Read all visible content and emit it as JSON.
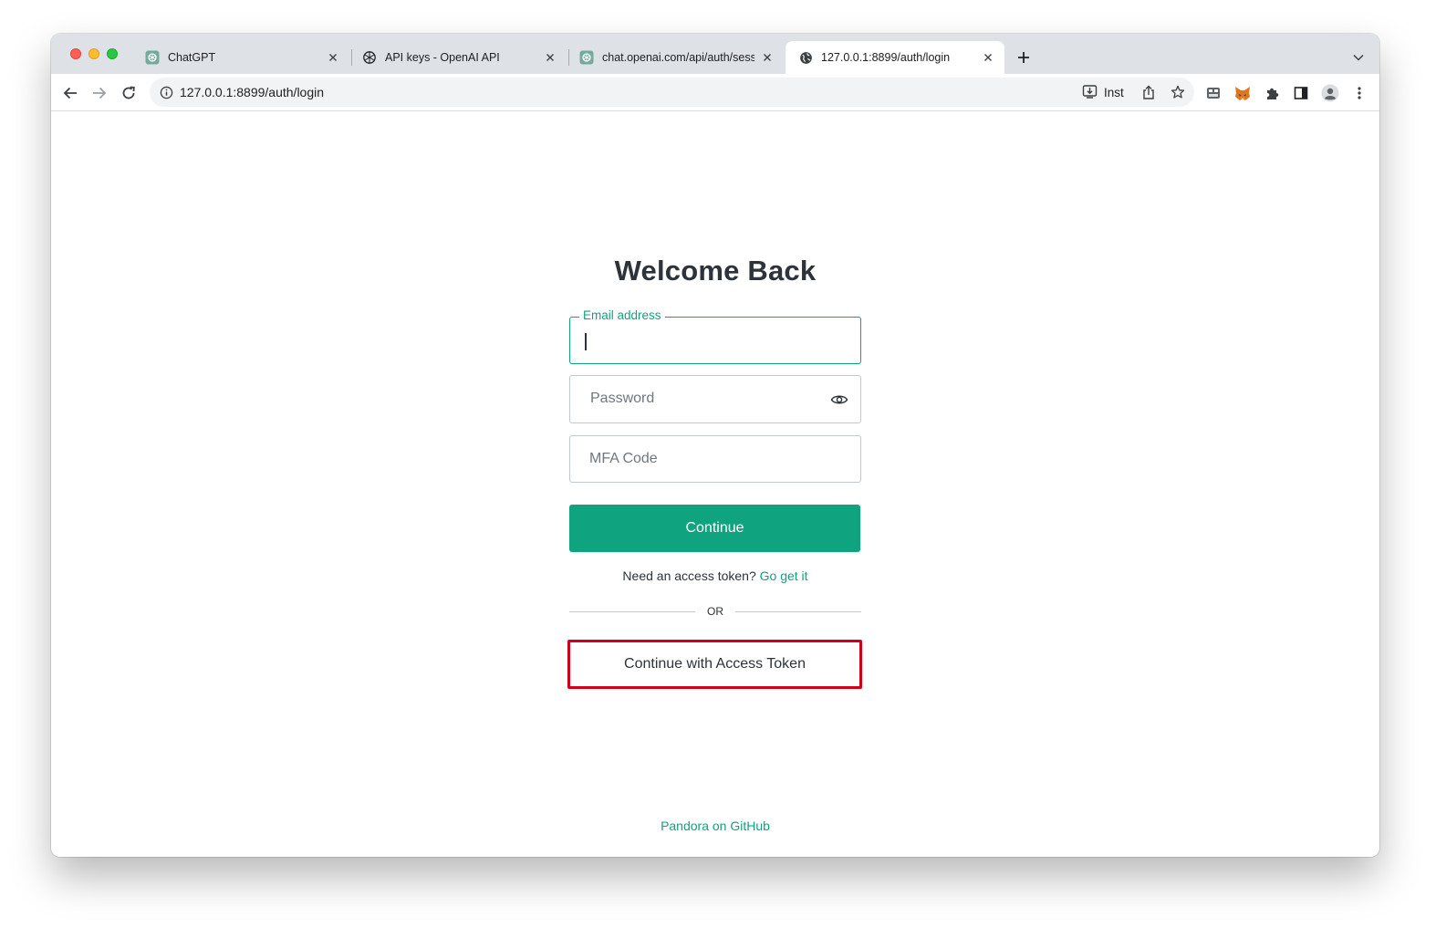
{
  "browser": {
    "tabs": [
      {
        "title": "ChatGPT",
        "icon": "chatgpt-icon"
      },
      {
        "title": "API keys - OpenAI API",
        "icon": "openai-icon"
      },
      {
        "title": "chat.openai.com/api/auth/session",
        "icon": "chatgpt-icon"
      },
      {
        "title": "127.0.0.1:8899/auth/login",
        "icon": "globe-icon"
      }
    ],
    "active_tab": 3,
    "address": "127.0.0.1:8899/auth/login",
    "install_label": "Inst"
  },
  "login": {
    "heading": "Welcome Back",
    "email_label": "Email address",
    "email_value": "",
    "password_placeholder": "Password",
    "mfa_placeholder": "MFA Code",
    "continue_label": "Continue",
    "token_prompt": "Need an access token?",
    "token_link": "Go get it",
    "or_label": "OR",
    "token_button_label": "Continue with Access Token",
    "footer_link": "Pandora on GitHub"
  },
  "colors": {
    "accent": "#10a37f",
    "highlight_border": "#d0021b",
    "text": "#2d333a"
  }
}
